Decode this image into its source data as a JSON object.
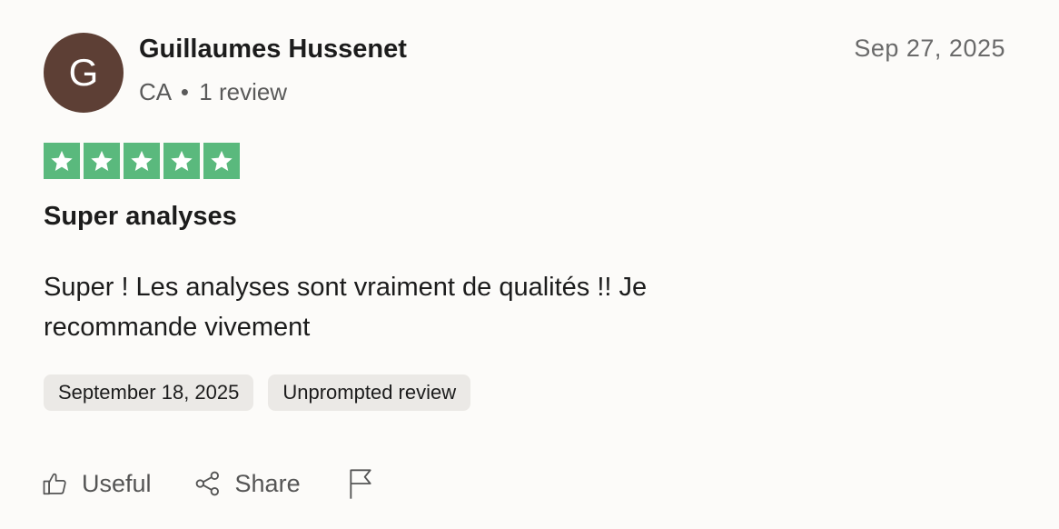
{
  "reviewer": {
    "initial": "G",
    "name": "Guillaumes Hussenet",
    "country": "CA",
    "separator": "•",
    "review_count": "1 review",
    "avatar_color": "#5d3f35"
  },
  "review": {
    "date": "Sep 27, 2025",
    "rating": 5,
    "max_rating": 5,
    "star_color": "#5ab97d",
    "title": "Super analyses",
    "body": "Super ! Les analyses sont vraiment de qualités !! Je recommande vivement",
    "tags": [
      "September 18, 2025",
      "Unprompted review"
    ]
  },
  "actions": {
    "useful_label": "Useful",
    "share_label": "Share",
    "useful_icon": "thumbs-up-icon",
    "share_icon": "share-icon",
    "report_icon": "flag-icon"
  }
}
